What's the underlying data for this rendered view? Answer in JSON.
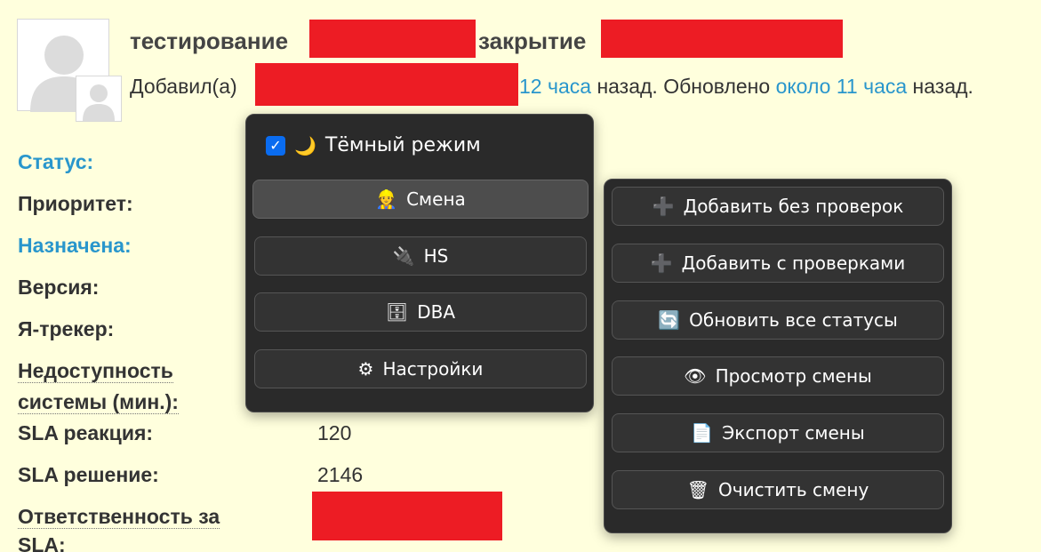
{
  "header": {
    "title_prefix": "тестирование",
    "title_middle": "закрытие",
    "meta_added": "Добавил(а)",
    "meta_added_time": "12 часа",
    "meta_updated": "назад. Обновлено",
    "meta_updated_time": "около 11 часа",
    "meta_suffix": "назад."
  },
  "attributes": {
    "status": "Статус:",
    "priority": "Приоритет:",
    "assigned": "Назначена:",
    "version": "Версия:",
    "tracker": "Я-трекер:",
    "downtime_1": "Недоступность",
    "downtime_2": "системы (мин.):",
    "sla_reaction": "SLA реакция:",
    "sla_reaction_value": "120",
    "sla_solution": "SLA решение:",
    "sla_solution_value": "2146",
    "sla_resp_1": "Ответственность за",
    "sla_resp_2": "SLA:"
  },
  "menu_left": {
    "dark_mode_checked": true,
    "dark_mode_icon": "moon-icon",
    "dark_mode_label": "Тёмный режим",
    "items": [
      {
        "icon": "worker-icon",
        "glyph": "👷",
        "label": "Смена"
      },
      {
        "icon": "plug-icon",
        "glyph": "🔌",
        "label": "HS"
      },
      {
        "icon": "file-cabinet-icon",
        "glyph": "🗄",
        "label": "DBA"
      },
      {
        "icon": "gear-icon",
        "glyph": "⚙",
        "label": "Настройки"
      }
    ]
  },
  "menu_right": {
    "items": [
      {
        "icon": "plus-icon",
        "glyph": "➕",
        "label": "Добавить без проверок"
      },
      {
        "icon": "plus-icon",
        "glyph": "➕",
        "label": "Добавить с проверками"
      },
      {
        "icon": "refresh-icon",
        "glyph": "🔄",
        "label": "Обновить все статусы"
      },
      {
        "icon": "eye-icon",
        "glyph": "👁",
        "label": "Просмотр смены"
      },
      {
        "icon": "page-icon",
        "glyph": "📄",
        "label": "Экспорт смены"
      },
      {
        "icon": "trash-icon",
        "glyph": "🗑",
        "label": "Очистить смену"
      }
    ]
  },
  "colors": {
    "background": "#ffffdd",
    "link": "#2996cc",
    "redaction": "#ed1c24",
    "popup_bg": "#2a2a2a",
    "checkbox": "#0a6cf0"
  }
}
